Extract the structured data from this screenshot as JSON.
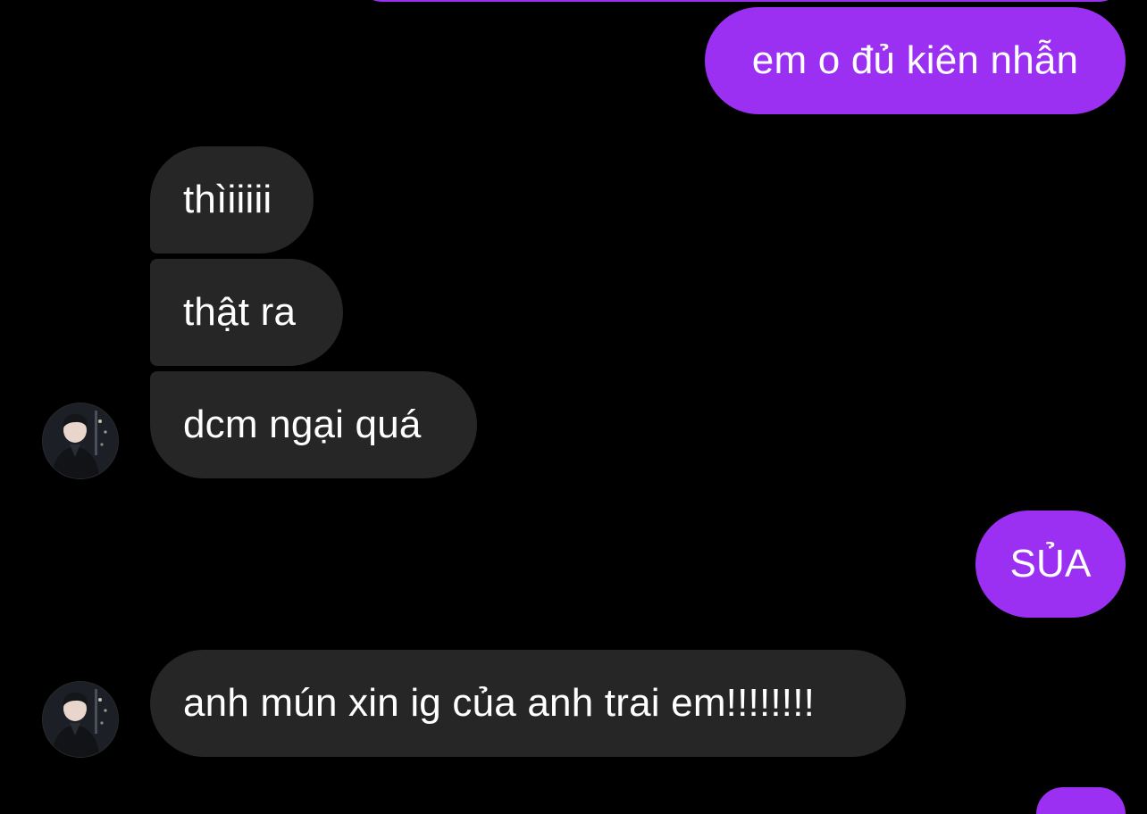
{
  "chat": {
    "messages": [
      {
        "id": "m1",
        "direction": "outgoing",
        "text": "em o đủ kiên nhẫn"
      },
      {
        "id": "m2",
        "direction": "incoming",
        "text": "thìiiiii"
      },
      {
        "id": "m3",
        "direction": "incoming",
        "text": "thật ra"
      },
      {
        "id": "m4",
        "direction": "incoming",
        "text": "dcm ngại quá",
        "show_avatar": true
      },
      {
        "id": "m5",
        "direction": "outgoing",
        "text": "SỦA"
      },
      {
        "id": "m6",
        "direction": "incoming",
        "text": "anh mún xin ig của anh trai em!!!!!!!!",
        "show_avatar": true
      }
    ],
    "contact_avatar_icon": "person-photo-avatar"
  },
  "colors": {
    "background": "#000000",
    "sent_bubble": "#9b30f3",
    "received_bubble": "#262626",
    "text": "#ffffff"
  }
}
